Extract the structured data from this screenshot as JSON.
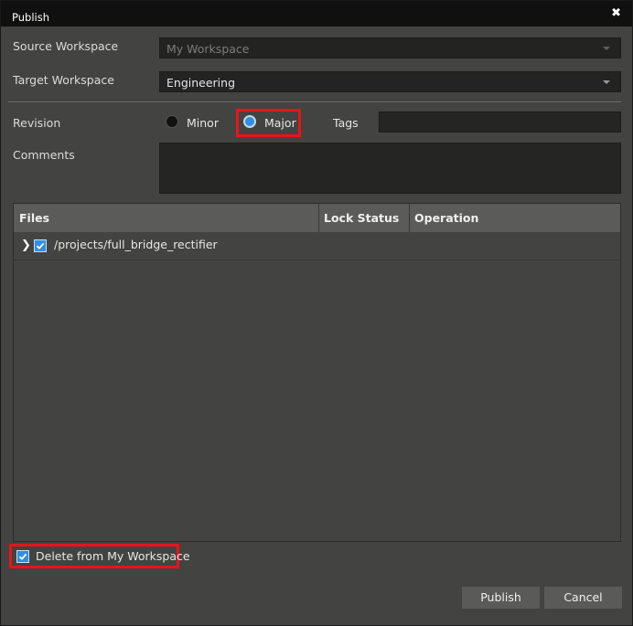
{
  "window": {
    "title": "Publish"
  },
  "source_workspace": {
    "label": "Source Workspace",
    "value": "My Workspace"
  },
  "target_workspace": {
    "label": "Target Workspace",
    "value": "Engineering"
  },
  "revision": {
    "label": "Revision",
    "options": [
      "Minor",
      "Major"
    ],
    "selected": "Major"
  },
  "tags": {
    "label": "Tags",
    "value": ""
  },
  "comments": {
    "label": "Comments",
    "value": ""
  },
  "files_table": {
    "columns": [
      "Files",
      "Lock Status",
      "Operation"
    ],
    "rows": [
      {
        "path": "/projects/full_bridge_rectifier",
        "checked": true,
        "lock_status": "",
        "operation": ""
      }
    ]
  },
  "delete_option": {
    "label": "Delete from My Workspace",
    "checked": true
  },
  "buttons": {
    "publish": "Publish",
    "cancel": "Cancel"
  },
  "colors": {
    "accent": "#2f8fe0",
    "highlight": "#e8141b",
    "titlebar": "#101010"
  }
}
